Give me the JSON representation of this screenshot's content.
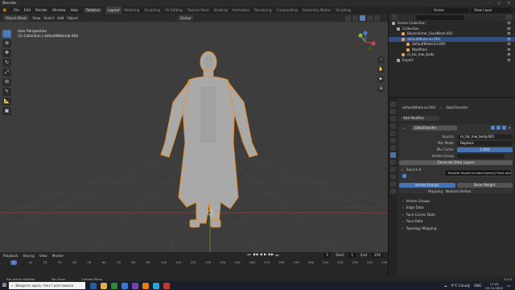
{
  "titlebar": {
    "title": "Blender"
  },
  "menubar": {
    "menus": [
      "File",
      "Edit",
      "Render",
      "Window",
      "Help"
    ],
    "mode_pill": "Relative",
    "workspaces": [
      "Layout",
      "Modeling",
      "Sculpting",
      "UV Editing",
      "Texture Paint",
      "Shading",
      "Animation",
      "Rendering",
      "Compositing",
      "Geometry Nodes",
      "Scripting"
    ],
    "scene": "Scene",
    "view_layer": "View Layer"
  },
  "viewport_header": {
    "mode": "Object Mode",
    "menus": [
      "View",
      "Select",
      "Add",
      "Object"
    ],
    "orientation": "Global"
  },
  "viewport": {
    "info_line1": "User Perspective",
    "info_line2": "(1) Collection | defaultMaterial.004"
  },
  "outliner": {
    "rows": [
      {
        "label": "Scene Collection",
        "indent": 0,
        "selected": false
      },
      {
        "label": "Collection",
        "indent": 1,
        "selected": false
      },
      {
        "label": "Blackshirter_FaceMesh.001",
        "indent": 2,
        "selected": false
      },
      {
        "label": "defaultMaterial.004",
        "indent": 2,
        "selected": true
      },
      {
        "label": "defaultMaterial.009",
        "indent": 3,
        "selected": false
      },
      {
        "label": "Modifiers",
        "indent": 3,
        "selected": false
      },
      {
        "label": "m_tai_mw_body",
        "indent": 2,
        "selected": false
      },
      {
        "label": "Export",
        "indent": 1,
        "selected": false
      }
    ]
  },
  "properties": {
    "breadcrumb_object": "defaultMaterial.004",
    "breadcrumb_modifier": "DataTransfer",
    "add_modifier": "Add Modifier",
    "modifier_name": "DataTransfer",
    "source_label": "Source",
    "source_value": "m_tai_mw_body.001",
    "mix_mode_label": "Mix Mode",
    "mix_mode_value": "Replace",
    "mix_factor_label": "Mix Factor",
    "mix_factor_value": "1.000",
    "vertex_group_label": "Vertex Group",
    "generate_button": "Generate Data Layers",
    "source_trunc": "Source d",
    "tab_vertex_groups": "Vertex Groups",
    "tab_bone_weight": "Bone Weight",
    "mapping_label": "Mapping",
    "mapping_value": "Nearest Vertex",
    "subpanels": [
      "Vertex Groups",
      "Edge Data",
      "Face Corner Data",
      "Face Data",
      "Topology Mapping"
    ]
  },
  "tooltip": {
    "text": "Transfer layout of data layer(s) from active to selected meshes"
  },
  "timeline": {
    "menus": [
      "Playback",
      "Keying",
      "View",
      "Marker"
    ],
    "current_frame": "1",
    "start_label": "Start",
    "start": "1",
    "end_label": "End",
    "end": "250",
    "ticks": [
      "1",
      "10",
      "20",
      "30",
      "40",
      "50",
      "60",
      "70",
      "80",
      "90",
      "100",
      "110",
      "120",
      "130",
      "140",
      "150",
      "160",
      "170",
      "180",
      "190",
      "200",
      "210",
      "220",
      "230",
      "240",
      "250"
    ]
  },
  "statusbar": {
    "items": [
      "Set Active Modifier",
      "Pan View",
      "Context Menu"
    ],
    "version": "3.4.0"
  },
  "taskbar": {
    "search_placeholder": "Введите здесь текст для поиска",
    "weather": "9°C Cloudy",
    "lang": "ENG",
    "time": "17:40",
    "date": "03.11.2022"
  }
}
